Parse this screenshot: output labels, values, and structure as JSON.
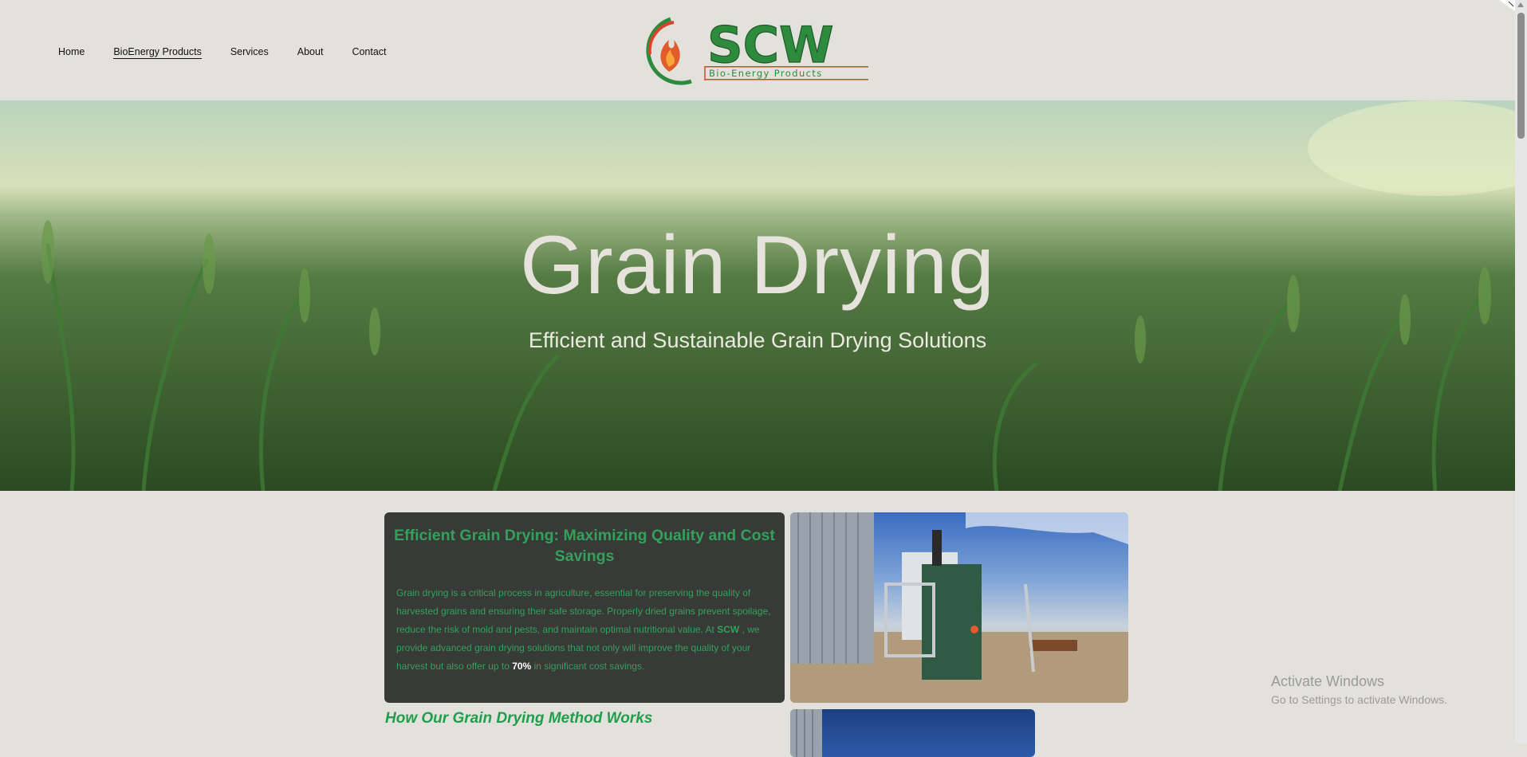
{
  "nav": {
    "items": [
      {
        "label": "Home"
      },
      {
        "label": "BioEnergy Products"
      },
      {
        "label": "Services"
      },
      {
        "label": "About"
      },
      {
        "label": "Contact"
      }
    ]
  },
  "logo": {
    "text": "SCW",
    "tagline": "Bio-Energy Products"
  },
  "hero": {
    "title": "Grain Drying",
    "subtitle": "Efficient and Sustainable Grain Drying Solutions"
  },
  "card": {
    "heading": "Efficient Grain Drying: Maximizing Quality and Cost Savings",
    "para_1": "Grain drying is a critical process in agriculture, essential for preserving the quality of harvested grains and ensuring their safe storage. Properly dried grains prevent spoilage, reduce the risk of mold and pests, and maintain optimal nutritional value. At ",
    "brand": "SCW",
    "para_2": " , we provide advanced grain drying solutions that not only will improve the quality of your harvest but also offer up to ",
    "percent": "70%",
    "para_3": " in significant cost savings."
  },
  "section": {
    "how_title": "How Our Grain Drying Method Works"
  },
  "watermark": {
    "line1": "Activate Windows",
    "line2": "Go to Settings to activate Windows."
  },
  "colors": {
    "accent_green": "#35a05c",
    "logo_green": "#2e8b3e",
    "logo_red": "#d8432b",
    "card_bg": "#373a36",
    "page_bg": "#e3e1dc"
  }
}
